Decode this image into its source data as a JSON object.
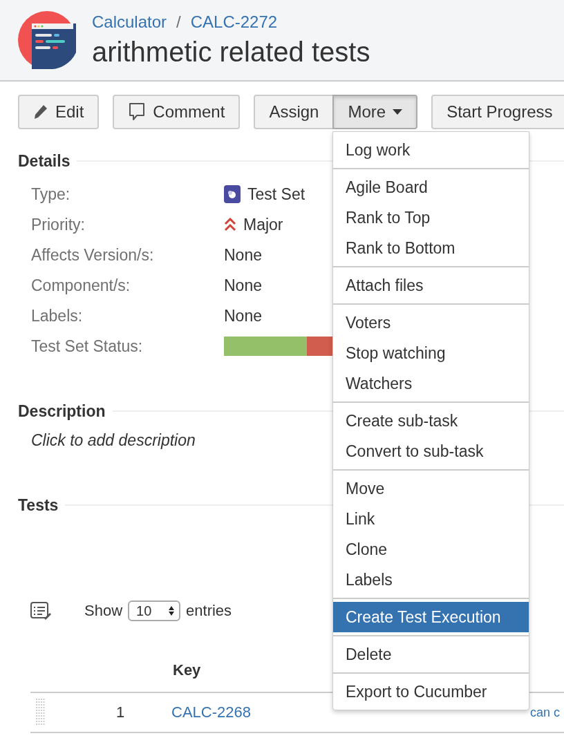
{
  "header": {
    "breadcrumbs": [
      "Calculator",
      "CALC-2272"
    ],
    "separator": "/",
    "title": "arithmetic related tests"
  },
  "toolbar": [
    {
      "buttons": [
        {
          "label": "Edit",
          "kind": "edit",
          "pressed": false
        }
      ]
    },
    {
      "buttons": [
        {
          "label": "Comment",
          "kind": "comment",
          "pressed": false
        }
      ]
    },
    {
      "buttons": [
        {
          "label": "Assign",
          "kind": "plain",
          "pressed": false
        },
        {
          "label": "More",
          "kind": "dropdown",
          "pressed": true
        }
      ]
    },
    {
      "buttons": [
        {
          "label": "Start Progress",
          "kind": "plain",
          "pressed": false
        }
      ]
    }
  ],
  "details": {
    "heading": "Details",
    "fields": [
      {
        "label": "Type:",
        "value": "Test Set",
        "kind": "type"
      },
      {
        "label": "Priority:",
        "value": "Major",
        "kind": "priority"
      },
      {
        "label": "Affects Version/s:",
        "value": "None",
        "kind": "text"
      },
      {
        "label": "Component/s:",
        "value": "None",
        "kind": "text"
      },
      {
        "label": "Labels:",
        "value": "None",
        "kind": "text"
      },
      {
        "label": "Test Set Status:",
        "kind": "status",
        "segments": [
          {
            "color": "#94c069",
            "level": 0.6
          },
          {
            "color": "#d15d4e",
            "level": 0.4
          }
        ]
      }
    ]
  },
  "description": {
    "heading": "Description",
    "placeholder": "Click to add description"
  },
  "tests": {
    "heading": "Tests",
    "show_entries": {
      "prefix": "Show",
      "value": "10",
      "suffix": "entries"
    },
    "columns": [
      {
        "label": "Key"
      }
    ],
    "rows": [
      {
        "index": "1",
        "key": "CALC-2268",
        "summary": "can c"
      }
    ]
  },
  "menu": {
    "groups": [
      {
        "items": [
          {
            "label": "Log work",
            "selected": false
          }
        ]
      },
      {
        "items": [
          {
            "label": "Agile Board",
            "selected": false
          },
          {
            "label": "Rank to Top",
            "selected": false
          },
          {
            "label": "Rank to Bottom",
            "selected": false
          }
        ]
      },
      {
        "items": [
          {
            "label": "Attach files",
            "selected": false
          }
        ]
      },
      {
        "items": [
          {
            "label": "Voters",
            "selected": false
          },
          {
            "label": "Stop watching",
            "selected": false
          },
          {
            "label": "Watchers",
            "selected": false
          }
        ]
      },
      {
        "items": [
          {
            "label": "Create sub-task",
            "selected": false
          },
          {
            "label": "Convert to sub-task",
            "selected": false
          }
        ]
      },
      {
        "items": [
          {
            "label": "Move",
            "selected": false
          },
          {
            "label": "Link",
            "selected": false
          },
          {
            "label": "Clone",
            "selected": false
          },
          {
            "label": "Labels",
            "selected": false
          }
        ]
      },
      {
        "items": [
          {
            "label": "Create Test Execution",
            "selected": true
          }
        ]
      },
      {
        "items": [
          {
            "label": "Delete",
            "selected": false
          }
        ]
      },
      {
        "items": [
          {
            "label": "Export to Cucumber",
            "selected": false
          }
        ]
      }
    ]
  }
}
